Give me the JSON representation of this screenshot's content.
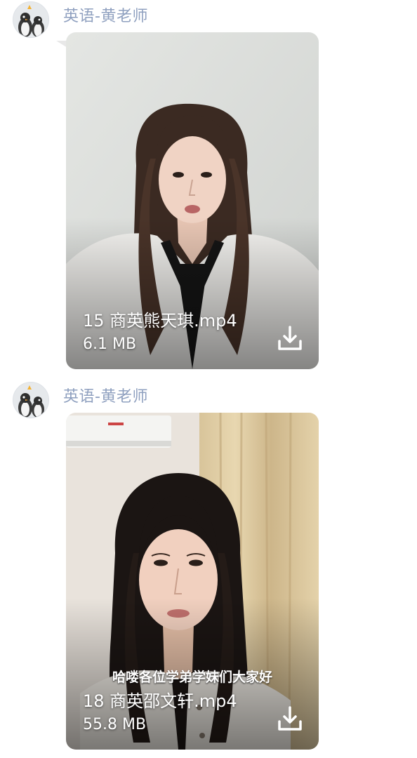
{
  "messages": [
    {
      "sender": "英语-黄老师",
      "avatar_icon": "penguin-avatar-icon",
      "video": {
        "file_name": "15 商英熊天琪.mp4",
        "file_size": "6.1 MB",
        "download_icon": "download-icon",
        "subtitle": ""
      }
    },
    {
      "sender": "英语-黄老师",
      "avatar_icon": "penguin-avatar-icon",
      "video": {
        "file_name": "18 商英邵文轩.mp4",
        "file_size": "55.8 MB",
        "download_icon": "download-icon",
        "subtitle": "哈喽各位学弟学妹们大家好"
      }
    }
  ],
  "colors": {
    "sender_name": "#8fa0bf",
    "background": "#ffffff",
    "overlay_text": "#ffffff"
  }
}
